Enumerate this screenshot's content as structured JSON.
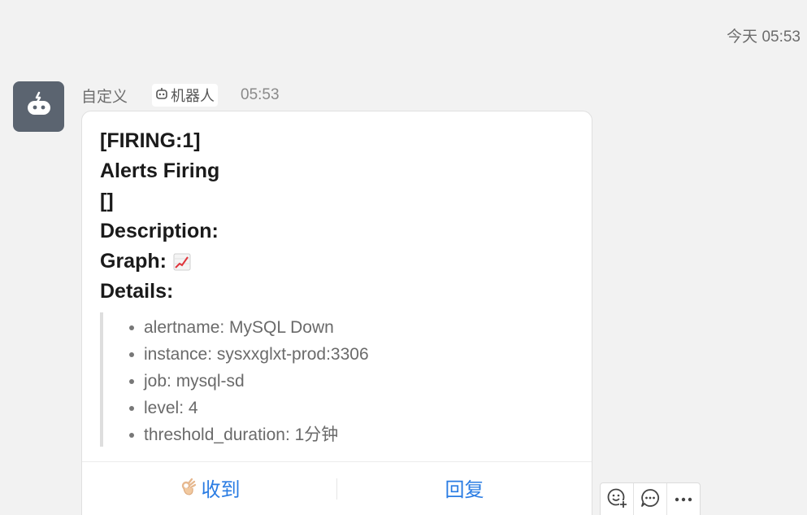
{
  "header": {
    "timestamp": "今天 05:53"
  },
  "message": {
    "sender": "自定义",
    "badge_label": "机器人",
    "time": "05:53",
    "lines": [
      "[FIRING:1]",
      "Alerts Firing",
      "[]",
      "Description:",
      "Graph:",
      "Details:"
    ],
    "details": [
      "alertname: MySQL Down",
      "instance: sysxxglxt-prod:3306",
      "job: mysql-sd",
      "level: 4",
      "threshold_duration: 1分钟"
    ],
    "actions": {
      "ack_label": "收到",
      "reply_label": "回复"
    }
  },
  "icons": {
    "avatar": "robot-avatar-icon",
    "badge": "robot-icon",
    "graph": "chart-increasing-icon",
    "ack": "ok-hand-icon",
    "toolbar": [
      "add-reaction-icon",
      "comment-icon",
      "more-icon"
    ]
  },
  "colors": {
    "background": "#f2f2f2",
    "avatar_bg": "#5b6470",
    "link_blue": "#2a7ce3",
    "card_bg": "#ffffff"
  }
}
